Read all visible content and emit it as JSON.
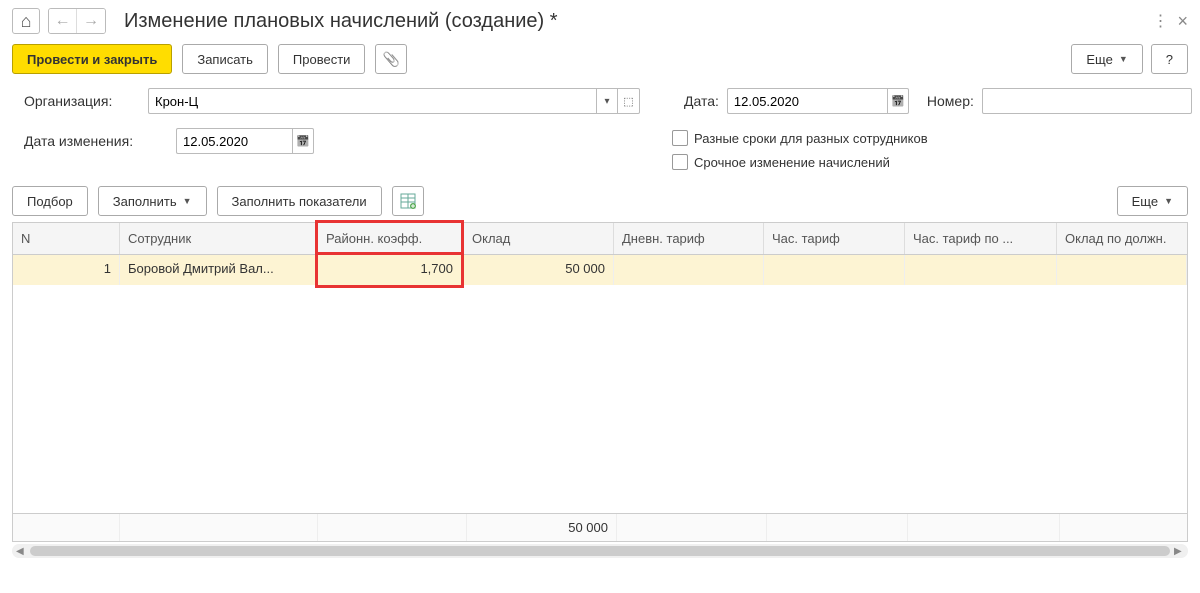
{
  "header": {
    "title": "Изменение плановых начислений (создание) *"
  },
  "toolbar": {
    "post_close": "Провести и закрыть",
    "save": "Записать",
    "post": "Провести",
    "more": "Еще",
    "help": "?"
  },
  "form": {
    "org_label": "Организация:",
    "org_value": "Крон-Ц",
    "date_label": "Дата:",
    "date_value": "12.05.2020",
    "number_label": "Номер:",
    "number_value": "",
    "change_date_label": "Дата изменения:",
    "change_date_value": "12.05.2020",
    "checkbox1": "Разные сроки для разных сотрудников",
    "checkbox2": "Срочное изменение начислений"
  },
  "table_toolbar": {
    "select": "Подбор",
    "fill": "Заполнить",
    "fill_indicators": "Заполнить показатели",
    "more": "Еще"
  },
  "table": {
    "headers": {
      "n": "N",
      "employee": "Сотрудник",
      "coef": "Районн. коэфф.",
      "salary": "Оклад",
      "day_rate": "Дневн. тариф",
      "hour_rate": "Час. тариф",
      "hour_rate_pos": "Час. тариф по ...",
      "salary_pos": "Оклад по должн."
    },
    "rows": [
      {
        "n": "1",
        "employee": "Боровой Дмитрий Вал...",
        "coef": "1,700",
        "salary": "50 000",
        "day_rate": "",
        "hour_rate": "",
        "hour_rate_pos": "",
        "salary_pos": ""
      }
    ],
    "footer": {
      "salary_total": "50 000"
    }
  }
}
